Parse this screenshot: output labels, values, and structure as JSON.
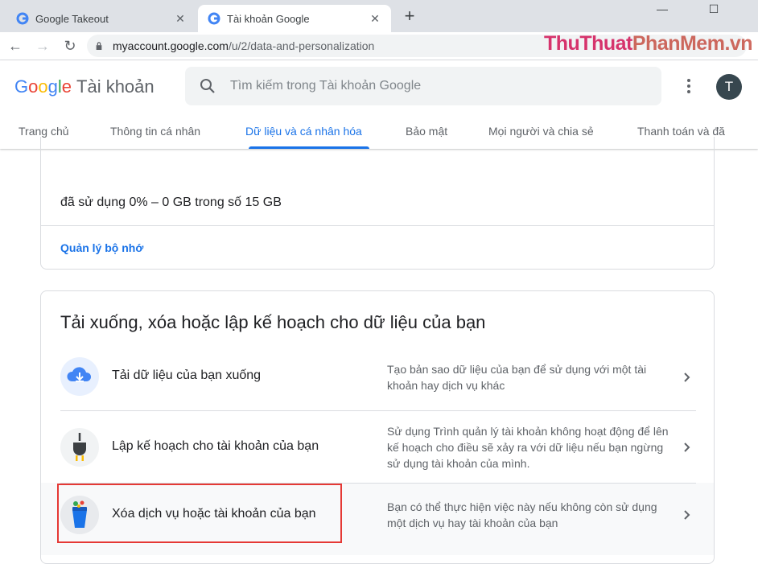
{
  "browser": {
    "tabs": [
      {
        "title": "Google Takeout"
      },
      {
        "title": "Tài khoản Google"
      }
    ],
    "url_host": "myaccount.google.com",
    "url_path": "/u/2/data-and-personalization",
    "watermark_a": "ThuThuat",
    "watermark_b": "PhanMem.vn"
  },
  "header": {
    "logo_letters": [
      "G",
      "o",
      "o",
      "g",
      "l",
      "e"
    ],
    "account_label": "Tài khoản",
    "search_placeholder": "Tìm kiếm trong Tài khoản Google",
    "avatar_initial": "T",
    "nav": [
      {
        "label": "Trang chủ"
      },
      {
        "label": "Thông tin cá nhân"
      },
      {
        "label": "Dữ liệu và cá nhân hóa"
      },
      {
        "label": "Bảo mật"
      },
      {
        "label": "Mọi người và chia sẻ"
      },
      {
        "label": "Thanh toán và đă"
      }
    ]
  },
  "storage_card": {
    "usage_text": "đã sử dụng 0% – 0 GB trong số 15 GB",
    "manage_link": "Quản lý bộ nhớ"
  },
  "data_card": {
    "title": "Tải xuống, xóa hoặc lập kế hoạch cho dữ liệu của bạn",
    "rows": [
      {
        "label": "Tải dữ liệu của bạn xuống",
        "desc": "Tạo bản sao dữ liệu của bạn để sử dụng với một tài khoản hay dịch vụ khác",
        "icon": "cloud-download-icon"
      },
      {
        "label": "Lập kế hoạch cho tài khoản của bạn",
        "desc": "Sử dụng Trình quản lý tài khoản không hoạt động để lên kế hoạch cho điều sẽ xảy ra với dữ liệu nếu bạn ngừng sử dụng tài khoản của mình.",
        "icon": "plug-icon"
      },
      {
        "label": "Xóa dịch vụ hoặc tài khoản của bạn",
        "desc": "Bạn có thể thực hiện việc này nếu không còn sử dụng một dịch vụ hay tài khoản của bạn",
        "icon": "trash-bin-icon"
      }
    ]
  },
  "colors": {
    "accent": "#1a73e8",
    "highlight_border": "#e53935"
  }
}
